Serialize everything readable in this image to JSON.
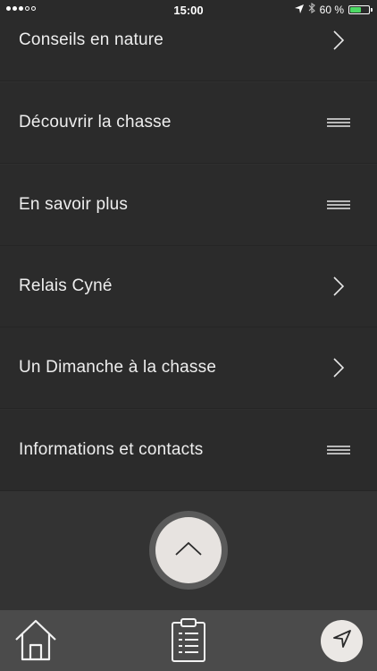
{
  "status_bar": {
    "time": "15:00",
    "battery_percent": "60 %",
    "battery_level": 0.6,
    "battery_color": "#4cd964",
    "signal_bars_filled": 3,
    "signal_bars_total": 5
  },
  "menu": {
    "items": [
      {
        "label": "Conseils en nature",
        "icon": "chevron-right-icon"
      },
      {
        "label": "Découvrir la chasse",
        "icon": "hamburger-icon"
      },
      {
        "label": "En savoir plus",
        "icon": "hamburger-icon"
      },
      {
        "label": "Relais Cyné",
        "icon": "chevron-right-icon"
      },
      {
        "label": "Un Dimanche à la chasse",
        "icon": "chevron-right-icon"
      },
      {
        "label": "Informations et contacts",
        "icon": "hamburger-icon"
      }
    ]
  },
  "scroll_up": {
    "icon": "chevron-up-icon"
  },
  "bottom_bar": {
    "home_icon": "home-icon",
    "clipboard_icon": "clipboard-list-icon",
    "locate_icon": "location-arrow-icon"
  },
  "colors": {
    "background": "#2f2f2f",
    "menu_item_bg": "#2b2b2b",
    "bottom_bar_bg": "#4b4b4b",
    "scroll_button_bg": "#e7e3e0",
    "text": "#eeeeee"
  }
}
